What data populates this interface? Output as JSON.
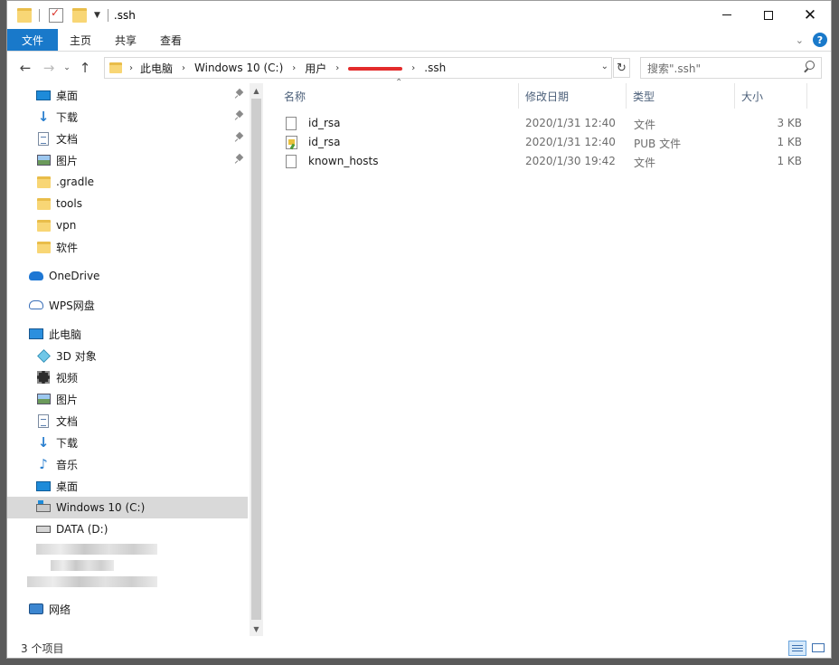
{
  "window": {
    "title": ".ssh",
    "controls": {
      "minimize_icon": "minimize-icon",
      "maximize_icon": "maximize-icon",
      "close_icon": "close-icon",
      "close_glyph": "✕"
    }
  },
  "ribbon": {
    "tabs": [
      "文件",
      "主页",
      "共享",
      "查看"
    ],
    "help": "?"
  },
  "address": {
    "root_label": "此电脑",
    "crumbs": [
      "此电脑",
      "Windows 10 (C:)",
      "用户",
      ".ssh"
    ],
    "redacted_segment": true
  },
  "search": {
    "placeholder": "搜索\".ssh\""
  },
  "nav_pane": {
    "quick_access": [
      {
        "label": "桌面",
        "icon": "desktop-icon",
        "pinned": true
      },
      {
        "label": "下载",
        "icon": "download-icon",
        "pinned": true
      },
      {
        "label": "文档",
        "icon": "document-icon",
        "pinned": true
      },
      {
        "label": "图片",
        "icon": "pictures-icon",
        "pinned": true
      },
      {
        "label": ".gradle",
        "icon": "folder-icon",
        "pinned": false
      },
      {
        "label": "tools",
        "icon": "folder-icon",
        "pinned": false
      },
      {
        "label": "vpn",
        "icon": "folder-icon",
        "pinned": false
      },
      {
        "label": "软件",
        "icon": "folder-icon",
        "pinned": false
      }
    ],
    "onedrive": "OneDrive",
    "wps": "WPS网盘",
    "this_pc": "此电脑",
    "pc_items": [
      {
        "label": "3D 对象",
        "icon": "3d-objects-icon"
      },
      {
        "label": "视频",
        "icon": "video-icon"
      },
      {
        "label": "图片",
        "icon": "pictures-icon"
      },
      {
        "label": "文档",
        "icon": "document-icon"
      },
      {
        "label": "下载",
        "icon": "download-icon"
      },
      {
        "label": "音乐",
        "icon": "music-icon"
      },
      {
        "label": "桌面",
        "icon": "desktop-icon"
      },
      {
        "label": "Windows 10 (C:)",
        "icon": "system-drive-icon",
        "selected": true
      },
      {
        "label": "DATA (D:)",
        "icon": "drive-icon"
      }
    ],
    "network": "网络"
  },
  "file_list": {
    "columns": {
      "name": "名称",
      "date": "修改日期",
      "type": "类型",
      "size": "大小"
    },
    "rows": [
      {
        "name": "id_rsa",
        "date": "2020/1/31 12:40",
        "type": "文件",
        "size": "3 KB",
        "icon": "file-icon"
      },
      {
        "name": "id_rsa",
        "date": "2020/1/31 12:40",
        "type": "PUB 文件",
        "size": "1 KB",
        "icon": "certificate-file-icon"
      },
      {
        "name": "known_hosts",
        "date": "2020/1/30 19:42",
        "type": "文件",
        "size": "1 KB",
        "icon": "file-icon"
      }
    ]
  },
  "status": {
    "item_count": "3 个项目"
  },
  "colors": {
    "accent": "#1979ca",
    "selected_nav": "#d9d9d9",
    "header_text": "#4c607a"
  }
}
